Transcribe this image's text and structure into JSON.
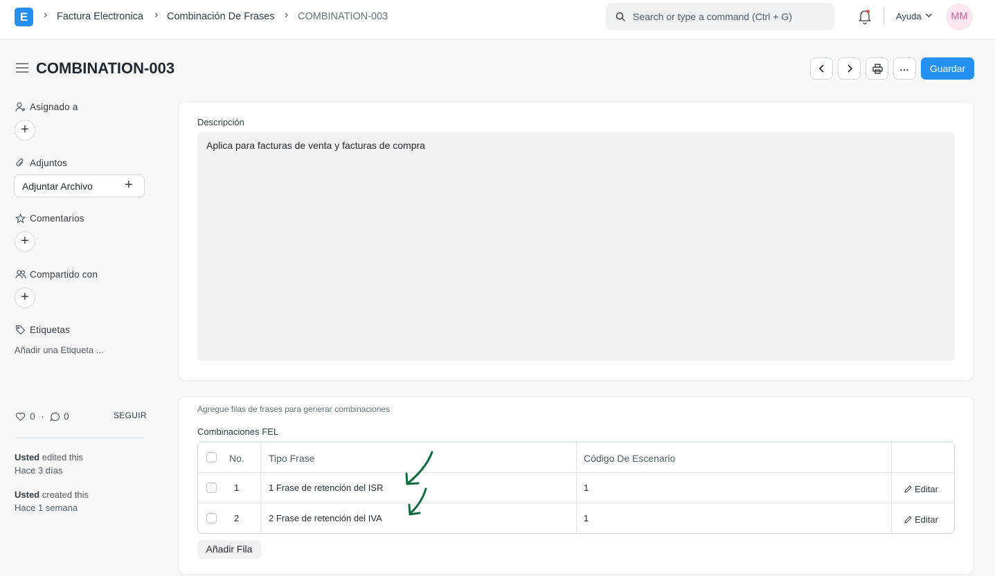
{
  "navbar": {
    "logo_letter": "E",
    "breadcrumbs": [
      "Factura Electronica",
      "Combinación De Frases",
      "COMBINATION-003"
    ],
    "search_placeholder": "Search or type a command (Ctrl + G)",
    "help_label": "Ayuda",
    "avatar_initials": "MM"
  },
  "header": {
    "title": "COMBINATION-003",
    "more_label": "...",
    "save_label": "Guardar"
  },
  "sidebar": {
    "assigned_label": "Asignado a",
    "attachments_label": "Adjuntos",
    "attach_button_label": "Adjuntar Archivo",
    "comments_label": "Comentarios",
    "shared_label": "Compartido con",
    "tags_label": "Etiquetas",
    "add_tag_label": "Añadir una Etiqueta ...",
    "likes_count": "0",
    "separator": "·",
    "comments_count": "0",
    "follow_label": "SEGUIR",
    "activity": [
      {
        "user": "Usted",
        "action": "edited this",
        "when": "Hace 3 días"
      },
      {
        "user": "Usted",
        "action": "created this",
        "when": "Hace 1 semana"
      }
    ]
  },
  "form": {
    "description_label": "Descripción",
    "description_value": "Aplica para facturas de venta y facturas de compra",
    "help_text": "Agregue filas de frases para generar combinaciones",
    "table_label": "Combinaciones FEL",
    "columns": [
      "No.",
      "Tipo Frase",
      "Código De Escenario"
    ],
    "rows": [
      {
        "no": "1",
        "tipo_frase": "1 Frase de retención del ISR",
        "codigo": "1",
        "edit_label": "Editar"
      },
      {
        "no": "2",
        "tipo_frase": "2 Frase de retención del IVA",
        "codigo": "1",
        "edit_label": "Editar"
      }
    ],
    "add_row_label": "Añadir Fila"
  },
  "colors": {
    "primary": "#2490ef",
    "annotation_arrow": "#0b6b3a",
    "avatar_bg": "#fce7f1",
    "avatar_text": "#e65596"
  }
}
